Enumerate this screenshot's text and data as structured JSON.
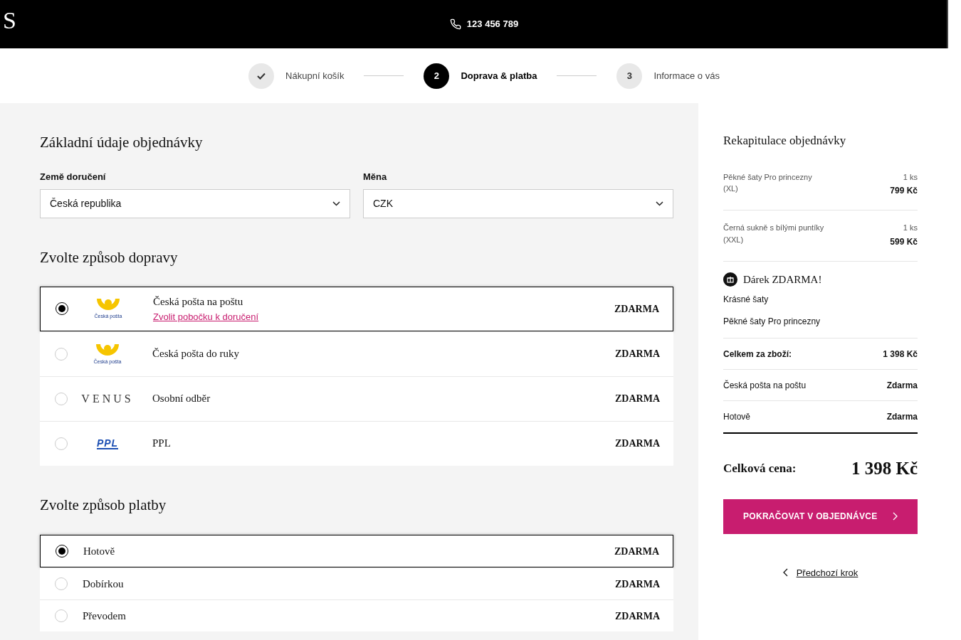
{
  "header": {
    "logo": "S",
    "phone": "123 456 789"
  },
  "steps": [
    {
      "label": "Nákupní košík",
      "completed": true,
      "selected": false
    },
    {
      "number": "2",
      "label": "Doprava & platba",
      "completed": false,
      "selected": true
    },
    {
      "number": "3",
      "label": "Informace o vás",
      "completed": false,
      "selected": false
    }
  ],
  "basics": {
    "title": "Základní údaje objednávky",
    "fields": [
      {
        "label": "Země doručení",
        "value": "Česká republika"
      },
      {
        "label": "Měna",
        "value": "CZK"
      }
    ]
  },
  "shipping": {
    "title": "Zvolte způsob dopravy",
    "options": [
      {
        "selected": true,
        "logo": {
          "kind": "ceska_posta",
          "text": "Česká pošta"
        },
        "name": "Česká pošta na poštu",
        "link": "Zvolit pobočku k doručení",
        "price": "ZDARMA"
      },
      {
        "selected": false,
        "logo": {
          "kind": "ceska_posta",
          "text": "Česká pošta"
        },
        "name": "Česká pošta do ruky",
        "price": "ZDARMA"
      },
      {
        "selected": false,
        "logo": {
          "kind": "venus",
          "text": "VENUS"
        },
        "name": "Osobní odběr",
        "price": "ZDARMA"
      },
      {
        "selected": false,
        "logo": {
          "kind": "ppl",
          "text": "PPL"
        },
        "name": "PPL",
        "price": "ZDARMA"
      }
    ]
  },
  "payment": {
    "title": "Zvolte způsob platby",
    "options": [
      {
        "selected": true,
        "name": "Hotově",
        "price": "ZDARMA"
      },
      {
        "selected": false,
        "name": "Dobírkou",
        "price": "ZDARMA"
      },
      {
        "selected": false,
        "name": "Převodem",
        "price": "ZDARMA"
      }
    ]
  },
  "summary": {
    "title": "Rekapitulace objednávky",
    "items": [
      {
        "name": "Pěkné šaty Pro princezny",
        "size": "(XL)",
        "qty": "1 ks",
        "price": "799 Kč"
      },
      {
        "name": "Černá sukně s bílými puntíky",
        "size": "(XXL)",
        "qty": "1 ks",
        "price": "599 Kč"
      }
    ],
    "gift": {
      "title": "Dárek ZDARMA!",
      "items": [
        "Krásné šaty",
        "Pěkné šaty Pro princezny"
      ]
    },
    "rows": [
      {
        "kind": "subtotal",
        "label": "Celkem za zboží:",
        "value": "1 398 Kč"
      },
      {
        "kind": "fee",
        "label": "Česká pošta na poštu",
        "value": "Zdarma"
      },
      {
        "kind": "fee",
        "label": "Hotově",
        "value": "Zdarma"
      }
    ],
    "total": {
      "label": "Celková cena:",
      "value": "1 398 Kč"
    },
    "continue_button": "POKRAČOVAT V OBJEDNÁVCE",
    "back_link": "Předchozí krok"
  }
}
